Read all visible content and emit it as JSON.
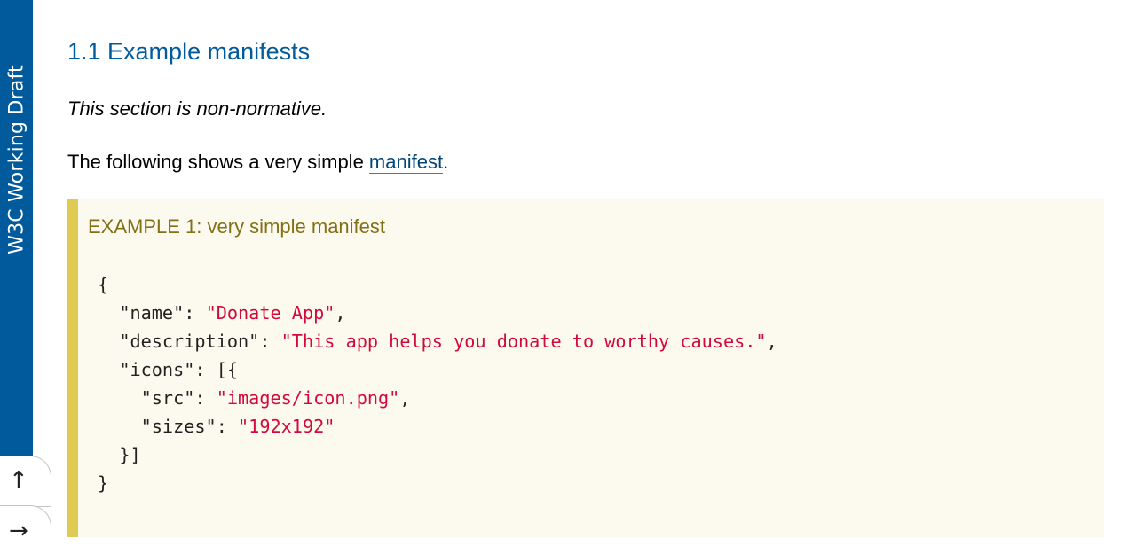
{
  "banner": {
    "label": "W3C Working Draft"
  },
  "nav": {
    "up_arrow": "↑",
    "down_arrow": "→"
  },
  "section": {
    "heading": "1.1 Example manifests",
    "non_normative": "This section is non-normative.",
    "intro_before": "The following shows a very simple ",
    "intro_link": "manifest",
    "intro_after": "."
  },
  "example": {
    "title": "EXAMPLE 1: very simple manifest",
    "code": {
      "open_brace": "{",
      "name_key": "\"name\"",
      "name_value": "\"Donate App\"",
      "description_key": "\"description\"",
      "description_value": "\"This app helps you donate to worthy causes.\"",
      "icons_key": "\"icons\"",
      "icons_open": "[{",
      "src_key": "\"src\"",
      "src_value": "\"images/icon.png\"",
      "sizes_key": "\"sizes\"",
      "sizes_value": "\"192x192\"",
      "icons_close": "}]",
      "close_brace": "}"
    }
  },
  "colors": {
    "heading": "#005a9c",
    "banner": "#005a9c",
    "example_border": "#e0cb52",
    "example_background": "#fcfaee",
    "example_title": "#827017",
    "code_string": "#d10a3b"
  }
}
